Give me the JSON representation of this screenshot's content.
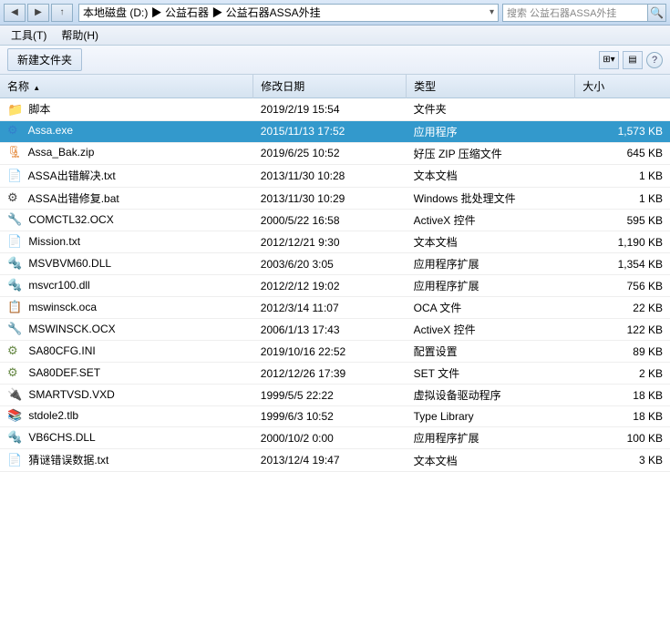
{
  "titlebar": {
    "address": "本地磁盘 (D:) ▶ 公益石器 ▶ 公益石器ASSA外挂",
    "address_parts": [
      "本地磁盘 (D:)",
      "公益石器",
      "公益石器ASSA外挂"
    ],
    "search_placeholder": "搜索 公益石器ASSA外挂",
    "expand_arrow": "▶"
  },
  "menubar": {
    "items": [
      "工具(T)",
      "帮助(H)"
    ]
  },
  "toolbar": {
    "new_folder_label": "新建文件夹"
  },
  "columns": {
    "name": "名称",
    "date": "修改日期",
    "type": "类型",
    "size": "大小"
  },
  "files": [
    {
      "icon": "folder",
      "name": "脚本",
      "date": "2019/2/19 15:54",
      "type": "文件夹",
      "size": "",
      "selected": false
    },
    {
      "icon": "exe",
      "name": "Assa.exe",
      "date": "2015/11/13 17:52",
      "type": "应用程序",
      "size": "1,573 KB",
      "selected": true
    },
    {
      "icon": "zip",
      "name": "Assa_Bak.zip",
      "date": "2019/6/25 10:52",
      "type": "好压 ZIP 压缩文件",
      "size": "645 KB",
      "selected": false
    },
    {
      "icon": "txt",
      "name": "ASSA出错解决.txt",
      "date": "2013/11/30 10:28",
      "type": "文本文档",
      "size": "1 KB",
      "selected": false
    },
    {
      "icon": "bat",
      "name": "ASSA出错修复.bat",
      "date": "2013/11/30 10:29",
      "type": "Windows 批处理文件",
      "size": "1 KB",
      "selected": false
    },
    {
      "icon": "ocx",
      "name": "COMCTL32.OCX",
      "date": "2000/5/22 16:58",
      "type": "ActiveX 控件",
      "size": "595 KB",
      "selected": false
    },
    {
      "icon": "txt",
      "name": "Mission.txt",
      "date": "2012/12/21 9:30",
      "type": "文本文档",
      "size": "1,190 KB",
      "selected": false
    },
    {
      "icon": "dll",
      "name": "MSVBVM60.DLL",
      "date": "2003/6/20 3:05",
      "type": "应用程序扩展",
      "size": "1,354 KB",
      "selected": false
    },
    {
      "icon": "dll",
      "name": "msvcr100.dll",
      "date": "2012/2/12 19:02",
      "type": "应用程序扩展",
      "size": "756 KB",
      "selected": false
    },
    {
      "icon": "oca",
      "name": "mswinsck.oca",
      "date": "2012/3/14 11:07",
      "type": "OCA 文件",
      "size": "22 KB",
      "selected": false
    },
    {
      "icon": "ocx",
      "name": "MSWINSCK.OCX",
      "date": "2006/1/13 17:43",
      "type": "ActiveX 控件",
      "size": "122 KB",
      "selected": false
    },
    {
      "icon": "ini",
      "name": "SA80CFG.INI",
      "date": "2019/10/16 22:52",
      "type": "配置设置",
      "size": "89 KB",
      "selected": false
    },
    {
      "icon": "set",
      "name": "SA80DEF.SET",
      "date": "2012/12/26 17:39",
      "type": "SET 文件",
      "size": "2 KB",
      "selected": false
    },
    {
      "icon": "vxd",
      "name": "SMARTVSD.VXD",
      "date": "1999/5/5 22:22",
      "type": "虚拟设备驱动程序",
      "size": "18 KB",
      "selected": false
    },
    {
      "icon": "tlb",
      "name": "stdole2.tlb",
      "date": "1999/6/3 10:52",
      "type": "Type Library",
      "size": "18 KB",
      "selected": false
    },
    {
      "icon": "dll",
      "name": "VB6CHS.DLL",
      "date": "2000/10/2 0:00",
      "type": "应用程序扩展",
      "size": "100 KB",
      "selected": false
    },
    {
      "icon": "txt",
      "name": "猜谜错误数据.txt",
      "date": "2013/12/4 19:47",
      "type": "文本文档",
      "size": "3 KB",
      "selected": false
    }
  ]
}
